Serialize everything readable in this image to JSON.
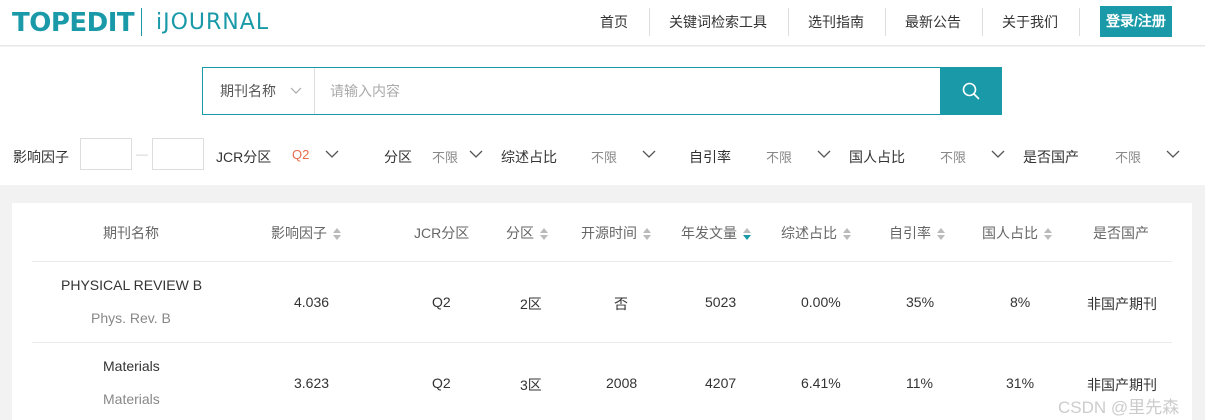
{
  "header": {
    "logo_main": "TOPEDIT",
    "logo_sub": "iJOURNAL",
    "nav": [
      "首页",
      "关键词检索工具",
      "选刊指南",
      "最新公告",
      "关于我们"
    ],
    "login": "登录/注册"
  },
  "search": {
    "type_label": "期刊名称",
    "placeholder": "请输入内容",
    "value": ""
  },
  "filters": {
    "impact_factor_label": "影响因子",
    "if_min": "",
    "if_max": "",
    "jcr_label": "JCR分区",
    "jcr_value": "Q2",
    "zone_label": "分区",
    "zone_value": "不限",
    "review_label": "综述占比",
    "review_value": "不限",
    "self_cite_label": "自引率",
    "self_cite_value": "不限",
    "chinese_label": "国人占比",
    "chinese_value": "不限",
    "domestic_label": "是否国产",
    "domestic_value": "不限"
  },
  "table": {
    "headers": [
      "期刊名称",
      "影响因子",
      "JCR分区",
      "分区",
      "开源时间",
      "年发文量",
      "综述占比",
      "自引率",
      "国人占比",
      "是否国产"
    ],
    "rows": [
      {
        "name": "PHYSICAL REVIEW B",
        "abbr": "Phys. Rev. B",
        "impact": "4.036",
        "jcr": "Q2",
        "zone": "2区",
        "open": "否",
        "annual": "5023",
        "review": "0.00%",
        "self_cite": "35%",
        "chinese": "8%",
        "domestic": "非国产期刊"
      },
      {
        "name": "Materials",
        "abbr": "Materials",
        "impact": "3.623",
        "jcr": "Q2",
        "zone": "3区",
        "open": "2008",
        "annual": "4207",
        "review": "6.41%",
        "self_cite": "11%",
        "chinese": "31%",
        "domestic": "非国产期刊"
      }
    ]
  },
  "watermark": "CSDN @里先森",
  "colors": {
    "accent": "#1a9aa8",
    "active_filter": "#e86c4a"
  }
}
